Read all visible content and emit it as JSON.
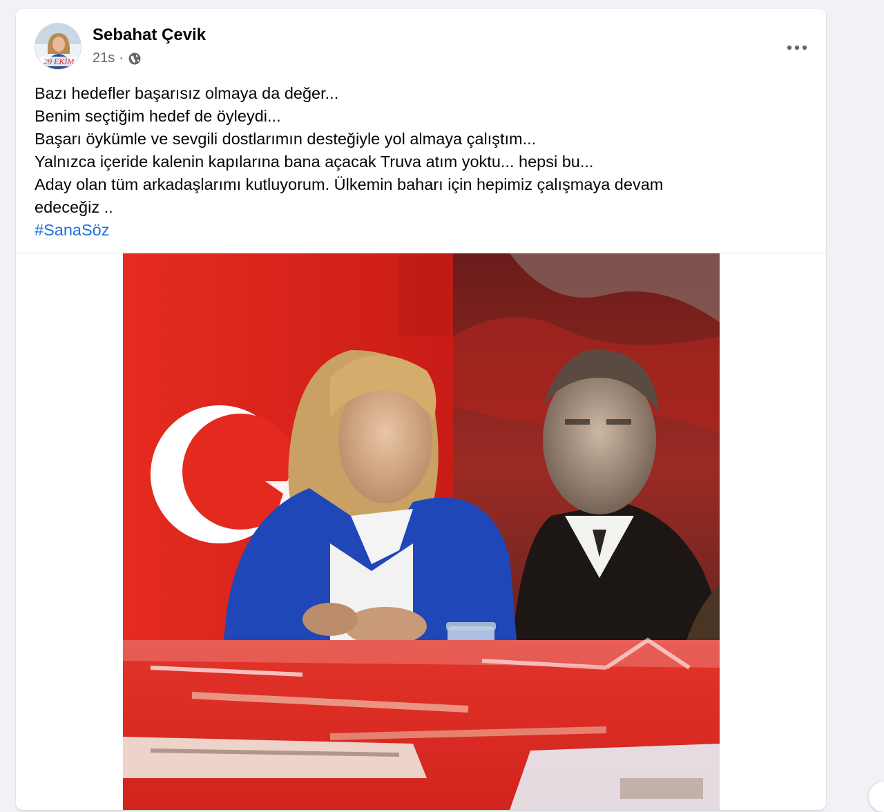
{
  "post": {
    "author": "Sebahat Çevik",
    "time": "21s",
    "separator": "·",
    "privacy_icon": "globe-icon",
    "more_icon": "more-horizontal-icon",
    "avatar_badge_text": "29 EKİM",
    "text_lines": [
      "Bazı hedefler başarısız olmaya da değer...",
      "Benim seçtiğim hedef de öyleydi...",
      "Başarı öykümle ve sevgili dostlarımın desteğiyle yol almaya çalıştım...",
      "Yalnızca içeride kalenin kapılarına bana açacak Truva atım yoktu... hepsi bu...",
      "Aday olan tüm arkadaşlarımı kutluyorum. Ülkemin baharı için hepimiz çalışmaya devam",
      "edeceğiz .."
    ],
    "hashtag": "#SanaSöz"
  },
  "colors": {
    "hashtag": "#216fdb",
    "flag_red": "#e2261e",
    "background": "#f0f2f5"
  }
}
